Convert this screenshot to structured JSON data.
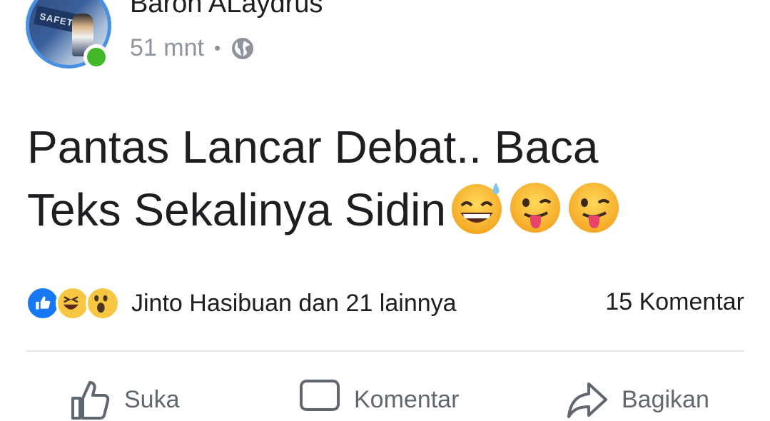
{
  "post": {
    "author_name": "Baron ALaydrus",
    "time": "51 mnt",
    "separator": "•",
    "privacy_icon": "globe-icon",
    "avatar_sign_text": "SAFETY",
    "text_line1": "Pantas Lancar Debat.. Baca",
    "text_line2": "Teks Sekalinya Sidin",
    "emojis": [
      "grinning-sweat",
      "winking-tongue",
      "winking-tongue"
    ]
  },
  "reactions": {
    "icons": [
      "like-icon",
      "haha-icon",
      "wow-icon"
    ],
    "summary": "Jinto Hasibuan dan 21 lainnya",
    "comments": "15 Komentar"
  },
  "actions": {
    "like_label": "Suka",
    "comment_label": "Komentar",
    "share_label": "Bagikan"
  },
  "colors": {
    "avatar_ring": "#4a90e2",
    "online": "#42b72a",
    "like_blue": "#1877f2",
    "emoji_yellow": "#f7c744",
    "meta_gray": "#8d949e"
  }
}
